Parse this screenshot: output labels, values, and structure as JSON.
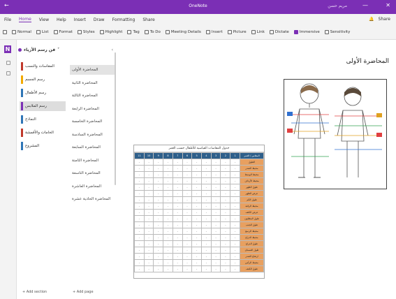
{
  "titlebar": {
    "title": "OneNote",
    "account": "مريم حسن",
    "minimize": "—",
    "close": "✕"
  },
  "menubar": {
    "items": [
      "File",
      "Home",
      "View",
      "Help",
      "Insert",
      "Draw",
      "Formatting",
      "Share"
    ],
    "active_index": 1,
    "right_label": "Share"
  },
  "ribbon": {
    "items": [
      {
        "icon": "undo-icon",
        "label": ""
      },
      {
        "icon": "bold-icon",
        "label": "Normal"
      },
      {
        "icon": "list-icon",
        "label": "List"
      },
      {
        "icon": "format-icon",
        "label": "Format"
      },
      {
        "icon": "styles-icon",
        "label": "Styles"
      },
      {
        "icon": "highlight-icon",
        "label": "Highlight"
      },
      {
        "icon": "tag-icon",
        "label": "Tag"
      },
      {
        "icon": "to-do-icon",
        "label": "To Do"
      },
      {
        "icon": "meeting-icon",
        "label": "Meeting Details"
      },
      {
        "icon": "insert-icon",
        "label": "Insert"
      },
      {
        "icon": "picture-icon",
        "label": "Picture"
      },
      {
        "icon": "link-icon",
        "label": "Link"
      },
      {
        "icon": "dictate-icon",
        "label": "Dictate"
      },
      {
        "icon": "immersive-icon",
        "label": "Immersive"
      },
      {
        "icon": "sensitivity-icon",
        "label": "Sensitivity"
      }
    ]
  },
  "notebook": {
    "name": "فن رسم الأزياء",
    "sections": [
      {
        "label": "المقاسات والنسب",
        "color": "#c0392b"
      },
      {
        "label": "رسم الجسم",
        "color": "#f2a900"
      },
      {
        "label": "رسم الأطفال",
        "color": "#2e75b6"
      },
      {
        "label": "رسم الملابس",
        "color": "#7b2fb5"
      },
      {
        "label": "النماذج",
        "color": "#2e75b6"
      },
      {
        "label": "الخامات والأقمشة",
        "color": "#c0392b"
      },
      {
        "label": "المشروع",
        "color": "#2e75b6"
      }
    ],
    "selected_section": 3,
    "pages": [
      "المحاضرة الأولى",
      "المحاضرة الثانية",
      "المحاضرة الثالثة",
      "المحاضرة الرابعة",
      "المحاضرة الخامسة",
      "المحاضرة السادسة",
      "المحاضرة السابعة",
      "المحاضرة الثامنة",
      "المحاضرة التاسعة",
      "المحاضرة العاشرة",
      "المحاضرة الحادية عشرة"
    ],
    "selected_page": 0,
    "add_section": "+ Add section",
    "add_page": "+ Add page"
  },
  "page": {
    "title": "المحاضرة الأولى",
    "figure_alt": "رسم قياسات جسم الطفل"
  },
  "measure_table": {
    "caption": "جدول المقاسات القياسية للأطفال حسب العمر",
    "header": [
      "المقاس / العمر",
      "1",
      "2",
      "3",
      "4",
      "5",
      "6",
      "7",
      "8",
      "9",
      "10",
      "11"
    ],
    "rows": [
      {
        "label": "الطول",
        "values": [
          "-",
          "-",
          "-",
          "-",
          "-",
          "-",
          "-",
          "-",
          "-",
          "-",
          "-"
        ]
      },
      {
        "label": "محيط الصدر",
        "values": [
          "-",
          "-",
          "-",
          "-",
          "-",
          "-",
          "-",
          "-",
          "-",
          "-",
          "-"
        ]
      },
      {
        "label": "محيط الوسط",
        "values": [
          "-",
          "-",
          "-",
          "-",
          "-",
          "-",
          "-",
          "-",
          "-",
          "-",
          "-"
        ]
      },
      {
        "label": "محيط الأرداف",
        "values": [
          "-",
          "-",
          "-",
          "-",
          "-",
          "-",
          "-",
          "-",
          "-",
          "-",
          "-"
        ]
      },
      {
        "label": "طول الظهر",
        "values": [
          "-",
          "-",
          "-",
          "-",
          "-",
          "-",
          "-",
          "-",
          "-",
          "-",
          "-"
        ]
      },
      {
        "label": "عرض الظهر",
        "values": [
          "-",
          "-",
          "-",
          "-",
          "-",
          "-",
          "-",
          "-",
          "-",
          "-",
          "-"
        ]
      },
      {
        "label": "طول الكم",
        "values": [
          "-",
          "-",
          "-",
          "-",
          "-",
          "-",
          "-",
          "-",
          "-",
          "-",
          "-"
        ]
      },
      {
        "label": "محيط الرقبة",
        "values": [
          "-",
          "-",
          "-",
          "-",
          "-",
          "-",
          "-",
          "-",
          "-",
          "-",
          "-"
        ]
      },
      {
        "label": "عرض الكتف",
        "values": [
          "-",
          "-",
          "-",
          "-",
          "-",
          "-",
          "-",
          "-",
          "-",
          "-",
          "-"
        ]
      },
      {
        "label": "طول البنطلون",
        "values": [
          "-",
          "-",
          "-",
          "-",
          "-",
          "-",
          "-",
          "-",
          "-",
          "-",
          "-"
        ]
      },
      {
        "label": "طول الجنب",
        "values": [
          "-",
          "-",
          "-",
          "-",
          "-",
          "-",
          "-",
          "-",
          "-",
          "-",
          "-"
        ]
      },
      {
        "label": "محيط الرسغ",
        "values": [
          "-",
          "-",
          "-",
          "-",
          "-",
          "-",
          "-",
          "-",
          "-",
          "-",
          "-"
        ]
      },
      {
        "label": "محيط الذراع",
        "values": [
          "-",
          "-",
          "-",
          "-",
          "-",
          "-",
          "-",
          "-",
          "-",
          "-",
          "-"
        ]
      },
      {
        "label": "طول الذراع",
        "values": [
          "-",
          "-",
          "-",
          "-",
          "-",
          "-",
          "-",
          "-",
          "-",
          "-",
          "-"
        ]
      },
      {
        "label": "طول الفستان",
        "values": [
          "-",
          "-",
          "-",
          "-",
          "-",
          "-",
          "-",
          "-",
          "-",
          "-",
          "-"
        ]
      },
      {
        "label": "ارتفاع الصدر",
        "values": [
          "-",
          "-",
          "-",
          "-",
          "-",
          "-",
          "-",
          "-",
          "-",
          "-",
          "-"
        ]
      },
      {
        "label": "محيط الرأس",
        "values": [
          "-",
          "-",
          "-",
          "-",
          "-",
          "-",
          "-",
          "-",
          "-",
          "-",
          "-"
        ]
      },
      {
        "label": "طول الكتف",
        "values": [
          "-",
          "-",
          "-",
          "-",
          "-",
          "-",
          "-",
          "-",
          "-",
          "-",
          "-"
        ]
      }
    ]
  },
  "colors": {
    "brand": "#7b2fb5",
    "table_header": "#2e5f8a",
    "table_label": "#e8a060"
  }
}
